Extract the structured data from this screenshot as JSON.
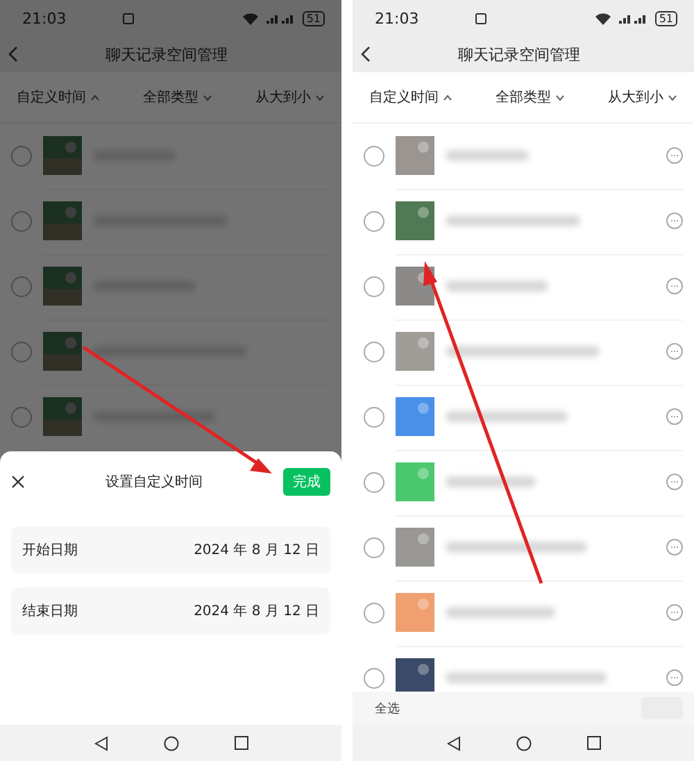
{
  "screens": [
    {
      "kind": "sheet",
      "status_bar": {
        "time": "21:03",
        "battery": "51"
      },
      "title": "聊天记录空间管理",
      "arrow": true,
      "filters": [
        {
          "label": "自定义时间",
          "expanded": true
        },
        {
          "label": "全部类型",
          "expanded": false
        },
        {
          "label": "从大到小",
          "expanded": false
        }
      ],
      "rows": [
        {
          "selected": false
        },
        {
          "selected": false
        },
        {
          "selected": false
        },
        {
          "selected": false
        },
        {
          "selected": false
        }
      ],
      "sheet": {
        "title": "设置自定义时间",
        "done": "完成",
        "fields": [
          {
            "label": "开始日期",
            "value": "2024 年 8 月 12 日"
          },
          {
            "label": "结束日期",
            "value": "2024 年 8 月 12 日"
          }
        ]
      }
    },
    {
      "kind": "list",
      "status_bar": {
        "time": "21:03",
        "battery": "51"
      },
      "title": "聊天记录空间管理",
      "arrow": true,
      "filters": [
        {
          "label": "自定义时间",
          "expanded": true
        },
        {
          "label": "全部类型",
          "expanded": false
        },
        {
          "label": "从大到小",
          "expanded": false
        }
      ],
      "rows": [
        {
          "selected": false,
          "color": "#9a9590"
        },
        {
          "selected": false,
          "color": "#4f7a55"
        },
        {
          "selected": false,
          "color": "#8c8a88"
        },
        {
          "selected": false,
          "color": "#a09c98"
        },
        {
          "selected": false,
          "color": "#4a90e8"
        },
        {
          "selected": false,
          "color": "#4cc870"
        },
        {
          "selected": false,
          "color": "#9a9894"
        },
        {
          "selected": false,
          "color": "#f0a070"
        },
        {
          "selected": false,
          "color": "#3a4a68"
        }
      ],
      "footer": {
        "select_all": "全选",
        "action_disabled": true
      }
    }
  ]
}
